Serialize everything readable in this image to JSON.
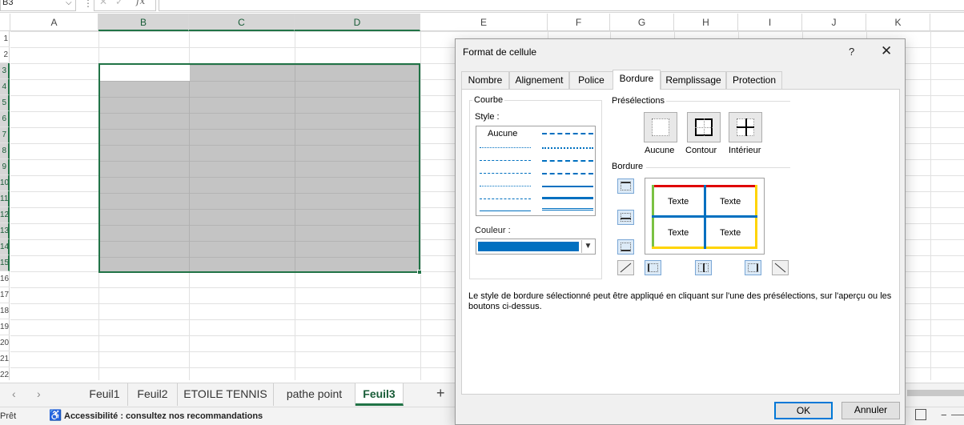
{
  "formula_bar": {
    "name_box": "B3",
    "fx": "fx",
    "formula": ""
  },
  "columns": [
    "A",
    "B",
    "C",
    "D",
    "E",
    "F",
    "G",
    "H",
    "I",
    "J",
    "K"
  ],
  "rows": [
    "1",
    "2",
    "3",
    "4",
    "5",
    "6",
    "7",
    "8",
    "9",
    "10",
    "11",
    "12",
    "13",
    "14",
    "15",
    "16",
    "17",
    "18",
    "19",
    "20",
    "21",
    "22"
  ],
  "sheets": {
    "tabs": [
      "Feuil1",
      "Feuil2",
      "ETOILE TENNIS",
      "pathe point",
      "Feuil3"
    ],
    "active": "Feuil3",
    "add": "+"
  },
  "status": {
    "ready": "Prêt",
    "accessibility": "Accessibilité : consultez nos recommandations"
  },
  "dialog": {
    "title": "Format de cellule",
    "help": "?",
    "close": "✕",
    "tabs": [
      "Nombre",
      "Alignement",
      "Police",
      "Bordure",
      "Remplissage",
      "Protection"
    ],
    "active_tab": "Bordure",
    "courbe": {
      "legend": "Courbe",
      "style_label": "Style :",
      "none_label": "Aucune",
      "couleur_label": "Couleur :",
      "color": "#0070c0"
    },
    "preselections": {
      "legend": "Présélections",
      "items": [
        "Aucune",
        "Contour",
        "Intérieur"
      ]
    },
    "bordure": {
      "legend": "Bordure",
      "preview_texts": [
        "Texte",
        "Texte",
        "Texte",
        "Texte"
      ],
      "colors": {
        "top": "#e00000",
        "left": "#7ac143",
        "right": "#ffd400",
        "bottom": "#ffd400",
        "inner": "#0070c0"
      }
    },
    "help_text": "Le style de bordure sélectionné peut être appliqué en cliquant sur l'une des présélections, sur l'aperçu ou les boutons ci-dessus.",
    "ok": "OK",
    "cancel": "Annuler"
  }
}
